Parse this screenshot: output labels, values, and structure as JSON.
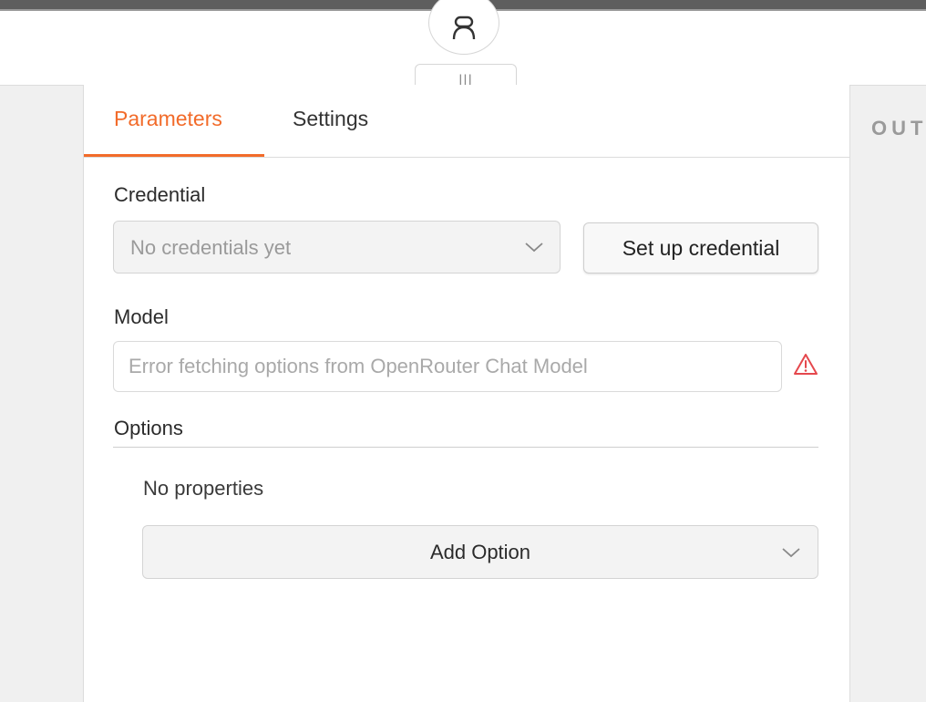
{
  "node": {
    "icon": "robot-icon",
    "handle_glyph": "|||"
  },
  "tabs": [
    {
      "label": "Parameters",
      "active": true
    },
    {
      "label": "Settings",
      "active": false
    }
  ],
  "credential": {
    "label": "Credential",
    "placeholder": "No credentials yet",
    "setup_button": "Set up credential"
  },
  "model": {
    "label": "Model",
    "placeholder": "Error fetching options from OpenRouter Chat Model",
    "warning_icon": "warning-icon"
  },
  "options": {
    "label": "Options",
    "empty_text": "No properties",
    "add_button": "Add Option"
  },
  "output_panel": {
    "label": "OUT"
  },
  "colors": {
    "accent": "#f26b2a",
    "warning": "#e5484d"
  }
}
